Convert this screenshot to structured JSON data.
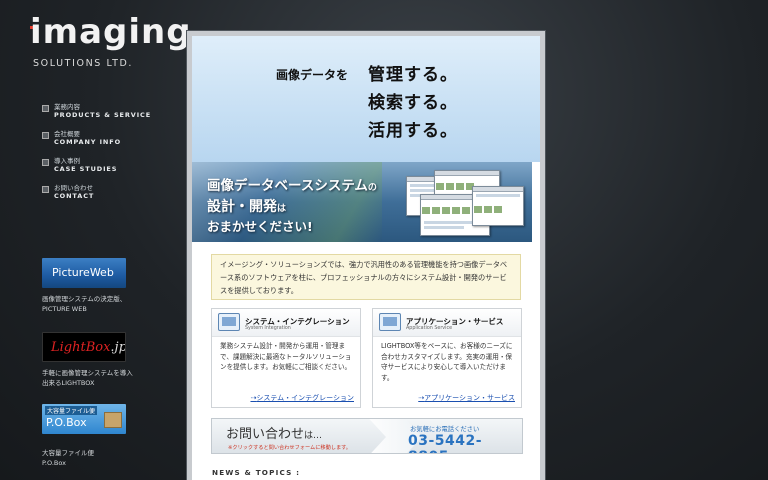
{
  "brand": {
    "logo_word": "imaging",
    "logo_sub": "SOLUTIONS LTD."
  },
  "nav": {
    "items": [
      {
        "jp": "業務内容",
        "en": "PRODUCTS & SERVICE"
      },
      {
        "jp": "会社概要",
        "en": "COMPANY INFO"
      },
      {
        "jp": "導入事例",
        "en": "CASE STUDIES"
      },
      {
        "jp": "お問い合わせ",
        "en": "CONTACT"
      }
    ]
  },
  "banners": [
    {
      "text": "PictureWeb",
      "caption_1": "画像管理システムの決定版、",
      "caption_2": "PICTURE WEB"
    },
    {
      "text_main": "LightBox",
      "text_suffix": ".jp",
      "caption_1": "手軽に画像管理システムを導入",
      "caption_2": "出来るLIGHTBOX"
    },
    {
      "tag": "大容量ファイル便",
      "text": "P.O.Box",
      "caption_1": "大容量ファイル便",
      "caption_2": "P.O.Box"
    }
  ],
  "hero": {
    "pre": "画像データを",
    "line_1": "管理する。",
    "line_2": "検索する。",
    "line_3": "活用する。"
  },
  "feature": {
    "line_1_main": "画像データベースシステム",
    "line_1_small": "の",
    "line_2_main": "設計・開発",
    "line_2_small": "は",
    "line_3": "おまかせください!"
  },
  "intro": {
    "text": "イメージング・ソリューションズでは、強力で汎用性のある管理機能を持つ画像データベース系のソフトウェアを柱に、プロフェッショナルの方々にシステム設計・開発のサービスを提供しております。"
  },
  "cards": [
    {
      "title": "システム・インテグレーション",
      "subtitle": "System Integration",
      "body": "業務システム設計・開発から運用・管理まで、課題解決に最適なトータルソリューションを提供します。お気軽にご相談ください。",
      "link": "システム・インテグレーション"
    },
    {
      "title": "アプリケーション・サービス",
      "subtitle": "Application Service",
      "body": "LIGHTBOX等をベースに、お客様のニーズに合わせカスタマイズします。充実の運用・保守サービスにより安心して導入いただけます。",
      "link": "アプリケーション・サービス"
    }
  ],
  "contact": {
    "title_main": "お問い合わせ",
    "title_small": "は…",
    "note": "※クリックすると問い合わせフォームに移動します。",
    "phone_label": "お気軽にお電話ください",
    "phone": "03-5442-8805"
  },
  "news": {
    "heading": "NEWS & TOPICS :"
  },
  "colors": {
    "page_bg": "#1f2327",
    "accent_blue": "#2a73c0",
    "logo_accent": [
      "#e23a2b",
      "#f2a51f",
      "#4bb34a"
    ]
  }
}
